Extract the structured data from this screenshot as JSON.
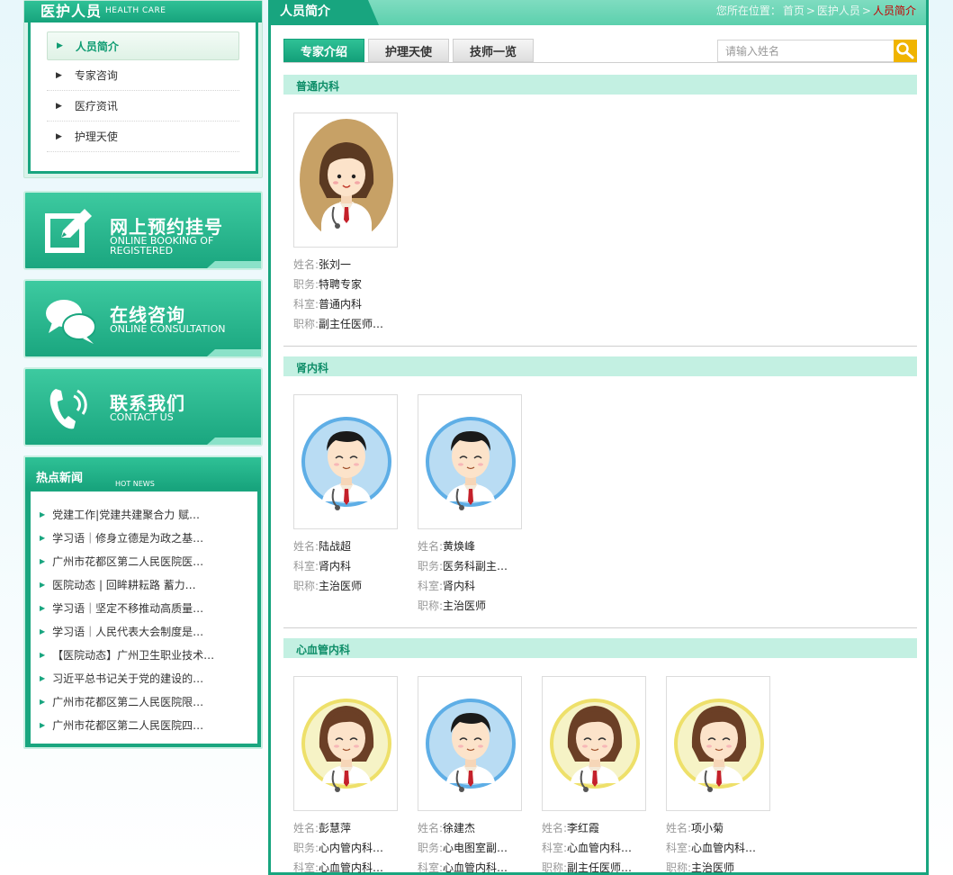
{
  "sidebar": {
    "category": {
      "title": "医护人员",
      "title_en": "HEALTH CARE",
      "items": [
        "人员简介",
        "专家咨询",
        "医疗资讯",
        "护理天使"
      ],
      "active": 0
    },
    "buttons": [
      {
        "cn": "网上预约挂号",
        "en": "ONLINE BOOKING OF REGISTERED",
        "icon": "edit-icon"
      },
      {
        "cn": "在线咨询",
        "en": "ONLINE CONSULTATION",
        "icon": "chat-bubbles-icon"
      },
      {
        "cn": "联系我们",
        "en": "CONTACT US",
        "icon": "phone-icon"
      }
    ],
    "news": {
      "title": "热点新闻",
      "title_en": "HOT NEWS",
      "items": [
        "党建工作|党建共建聚合力 赋…",
        "学习语｜修身立德是为政之基…",
        "广州市花都区第二人民医院医…",
        "医院动态 | 回眸耕耘路 蓄力…",
        "学习语｜坚定不移推动高质量…",
        "学习语｜人民代表大会制度是…",
        "【医院动态】广州卫生职业技术…",
        "习近平总书记关于党的建设的…",
        "广州市花都区第二人民医院限…",
        "广州市花都区第二人民医院四…"
      ]
    }
  },
  "main": {
    "title": "人员简介",
    "breadcrumb": {
      "prefix": "您所在位置：",
      "items": [
        "首页",
        "医护人员",
        "人员简介"
      ],
      "sep": ">"
    },
    "tabs": [
      "专家介绍",
      "护理天使",
      "技师一览"
    ],
    "active_tab": 0,
    "search": {
      "placeholder": "请输入姓名",
      "icon": "search-icon"
    },
    "labels": {
      "name": "姓名:",
      "post": "职务:",
      "dept": "科室:",
      "rank": "职称:"
    },
    "sections": [
      {
        "name": "普通内科",
        "doctors": [
          {
            "avatar": "female-tan",
            "name": "张刘一",
            "post": "特聘专家",
            "dept": "普通内科",
            "rank": "副主任医师…"
          }
        ]
      },
      {
        "name": "肾内科",
        "doctors": [
          {
            "avatar": "male-blue",
            "name": "陆战超",
            "dept": "肾内科",
            "rank": "主治医师"
          },
          {
            "avatar": "male-blue",
            "name": "黄焕峰",
            "post": "医务科副主…",
            "dept": "肾内科",
            "rank": "主治医师"
          }
        ]
      },
      {
        "name": "心血管内科",
        "doctors": [
          {
            "avatar": "female-yellow",
            "name": "彭慧萍",
            "post": "心内管内科…",
            "dept": "心血管内科…"
          },
          {
            "avatar": "male-blue",
            "name": "徐建杰",
            "post": "心电图室副…",
            "dept": "心血管内科…"
          },
          {
            "avatar": "female-yellow",
            "name": "李红霞",
            "dept": "心血管内科…",
            "rank": "副主任医师…"
          },
          {
            "avatar": "female-yellow",
            "name": "项小菊",
            "dept": "心血管内科…",
            "rank": "主治医师"
          }
        ]
      }
    ]
  },
  "colors": {
    "brand": "#18a57f",
    "brand_light": "#c3f0e2",
    "accent_search": "#f0b400",
    "current_crumb": "#c40000"
  }
}
